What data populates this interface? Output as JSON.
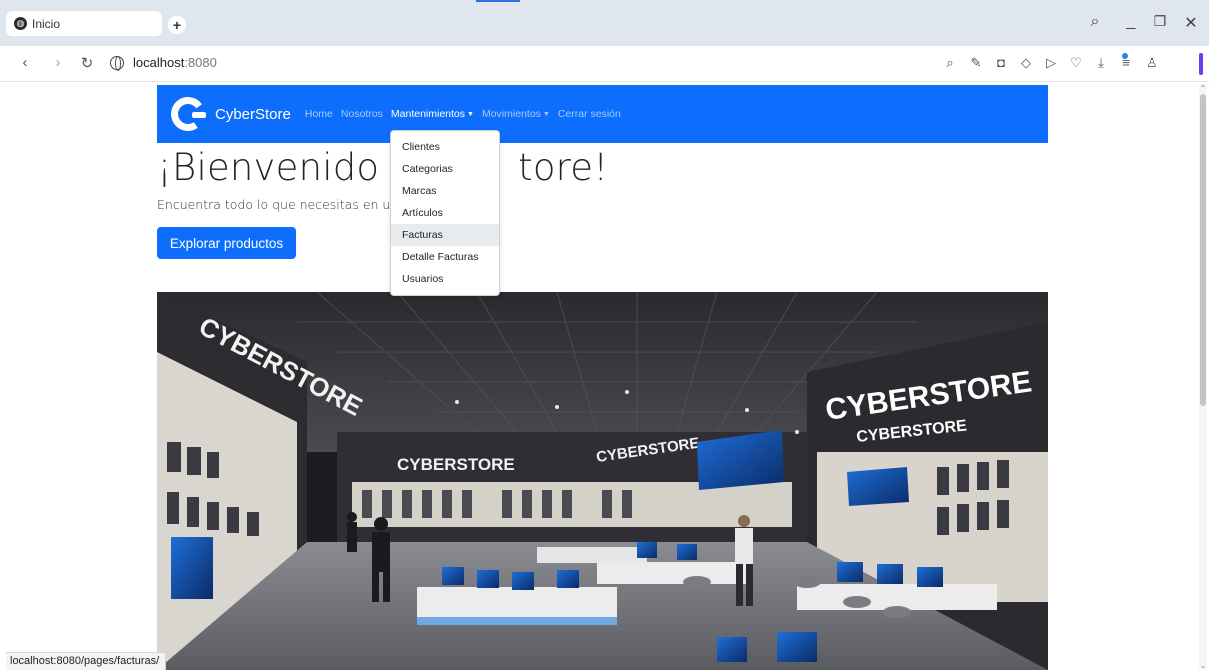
{
  "browser": {
    "tab_title": "Inicio",
    "new_tab": "+",
    "url_host": "localhost",
    "url_port": ":8080",
    "status_url": "localhost:8080/pages/facturas/",
    "window_controls": [
      "minimize",
      "restore",
      "close"
    ],
    "toolbar_icons": [
      "search-icon",
      "edit-icon",
      "camera-icon",
      "shield-icon",
      "send-icon",
      "heart-icon",
      "download-icon",
      "menu-icon",
      "user-icon"
    ]
  },
  "nav": {
    "brand": "CyberStore",
    "links": {
      "home": "Home",
      "nosotros": "Nosotros",
      "mantenimientos": "Mantenimientos",
      "movimientos": "Movimientos",
      "logout": "Cerrar sesión"
    },
    "accent_color": "#0d6efd"
  },
  "dropdown": {
    "items": [
      "Clientes",
      "Categorias",
      "Marcas",
      "Artículos",
      "Facturas",
      "Detalle Facturas",
      "Usuarios"
    ],
    "hovered": "Facturas"
  },
  "hero": {
    "title_left": "¡Bienvenido a C",
    "title_right": "tore!",
    "subtitle": "Encuentra todo lo que necesitas en un so",
    "cta": "Explorar productos"
  },
  "image": {
    "signs": [
      "CYBERSTORE",
      "CYBERSTORE",
      "CYBERSTORE",
      "CYBERSTORE",
      "CYBERSTORE"
    ]
  }
}
